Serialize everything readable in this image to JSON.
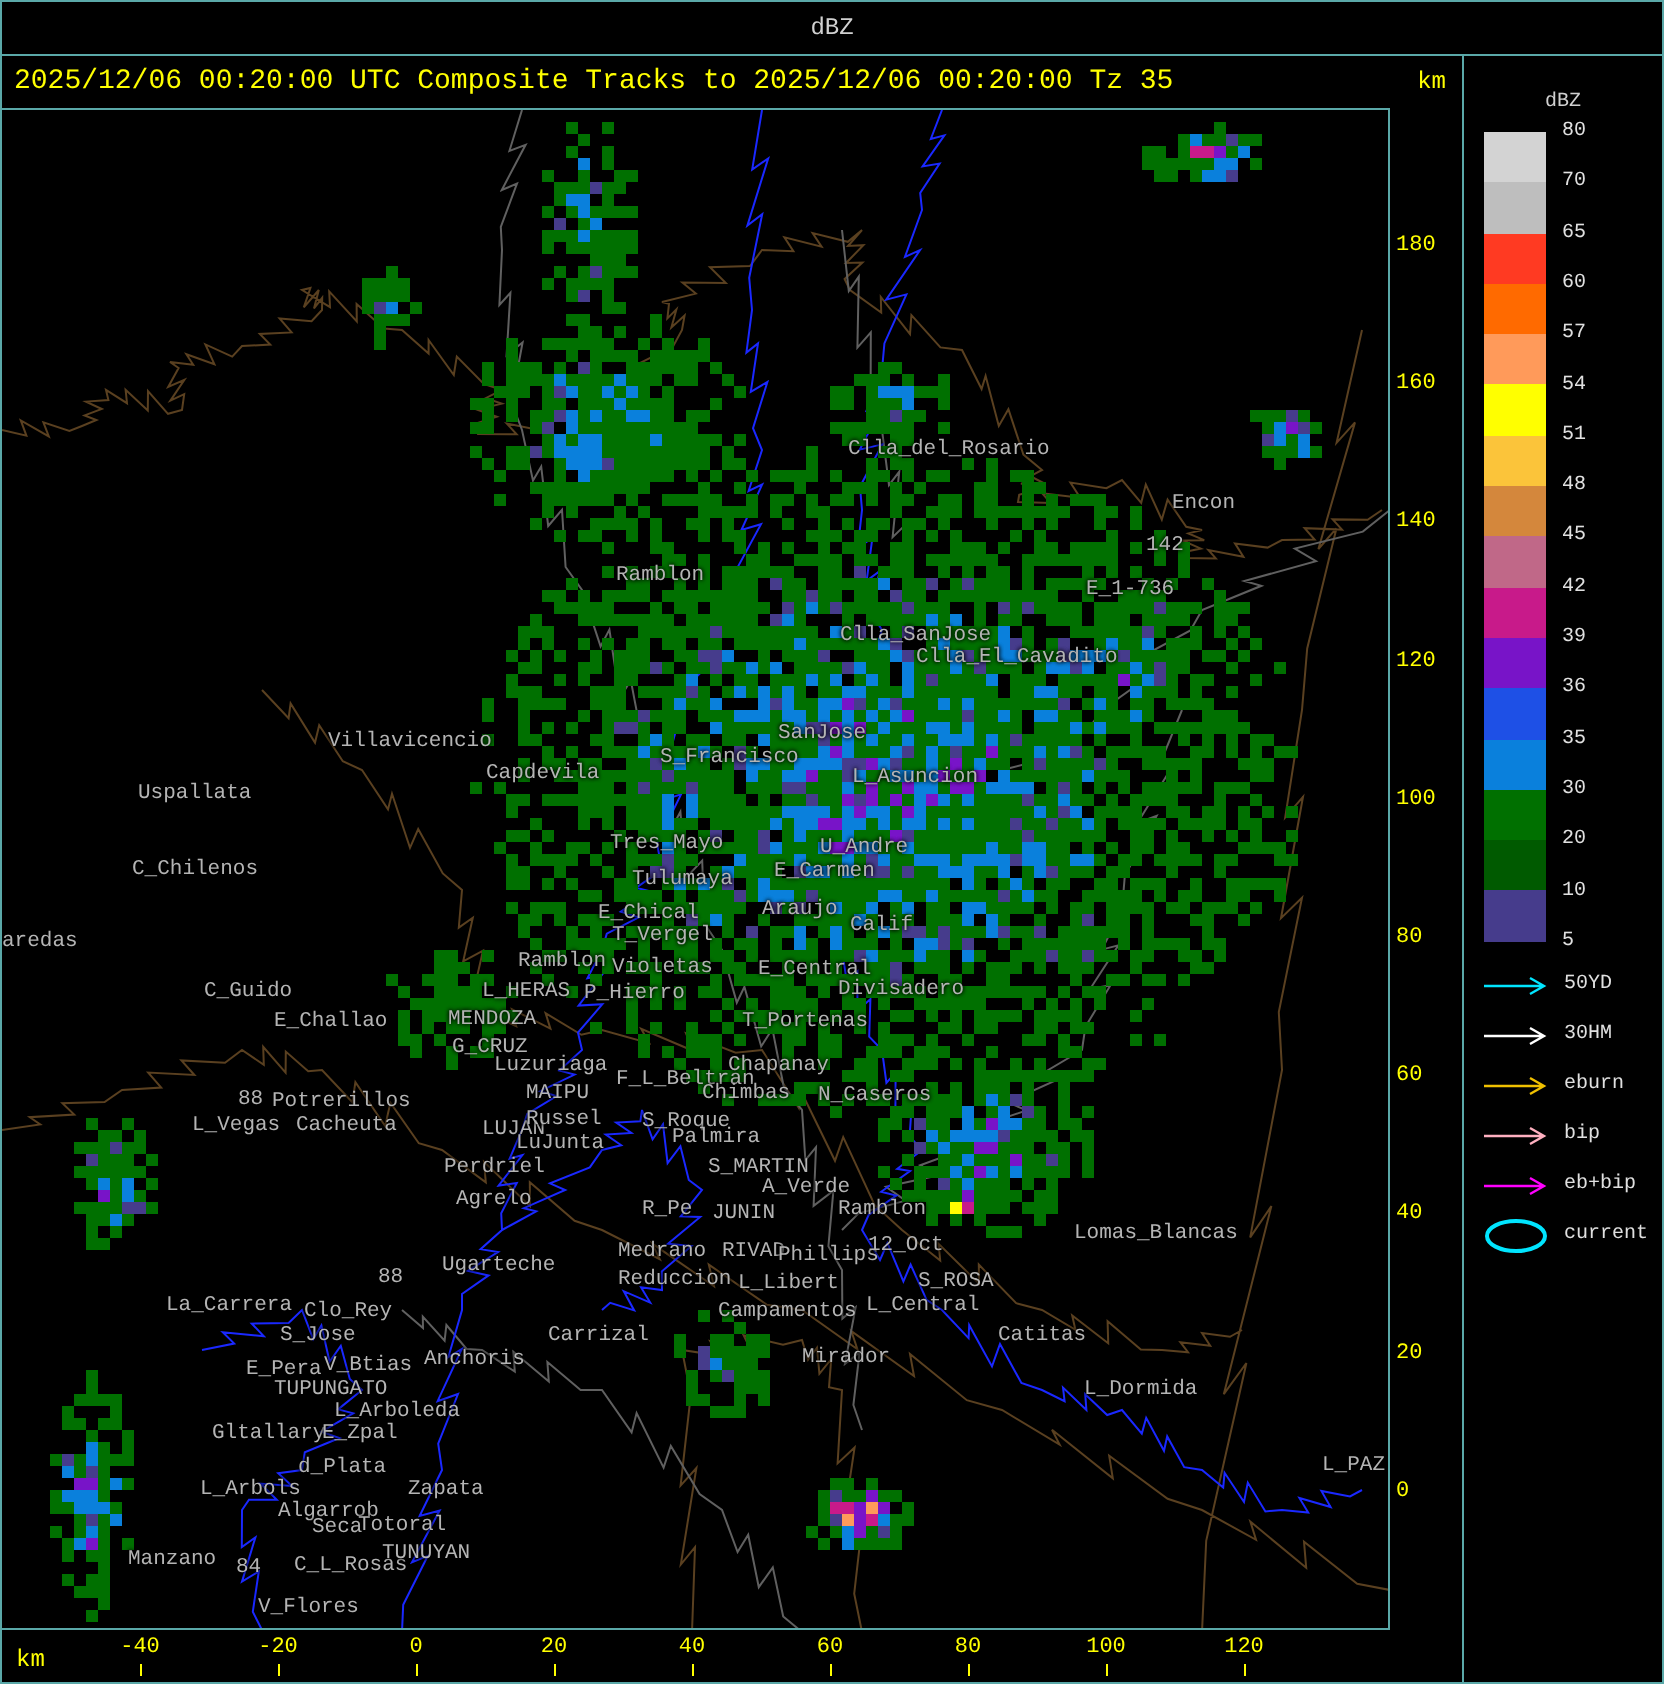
{
  "window": {
    "title": "dBZ"
  },
  "header": {
    "caption": "2025/12/06 00:20:00 UTC Composite Tracks to 2025/12/06 00:20:00 Tz 35",
    "unit": "km"
  },
  "map": {
    "places": [
      {
        "name": "Clla_del_Rosario"
      },
      {
        "name": "Encon"
      },
      {
        "name": "142"
      },
      {
        "name": "Ramblon"
      },
      {
        "name": "E_1-736"
      },
      {
        "name": "Clla_SanJose"
      },
      {
        "name": "Clla_El_Cavadito"
      },
      {
        "name": "Villavicencio"
      },
      {
        "name": "SanJose"
      },
      {
        "name": "Uspallata"
      },
      {
        "name": "Capdevila"
      },
      {
        "name": "S_Francisco"
      },
      {
        "name": "L_Asuncion"
      },
      {
        "name": "Tres_Mayo"
      },
      {
        "name": "C_Chilenos"
      },
      {
        "name": "Tulumaya"
      },
      {
        "name": "U_Andre"
      },
      {
        "name": "E_Carmen"
      },
      {
        "name": "E_Chical"
      },
      {
        "name": "Araujo"
      },
      {
        "name": "aredas"
      },
      {
        "name": "T_Vergel"
      },
      {
        "name": "Calif"
      },
      {
        "name": "Ramblon"
      },
      {
        "name": "Violetas"
      },
      {
        "name": "E_Central"
      },
      {
        "name": "C_Guido"
      },
      {
        "name": "L_HERAS"
      },
      {
        "name": "P_Hierro"
      },
      {
        "name": "Divisadero"
      },
      {
        "name": "E_Challao"
      },
      {
        "name": "MENDOZA"
      },
      {
        "name": "T_Portenas"
      },
      {
        "name": "G_CRUZ"
      },
      {
        "name": "Luzuriaga"
      },
      {
        "name": "88"
      },
      {
        "name": "Potrerillos"
      },
      {
        "name": "MAIPU"
      },
      {
        "name": "F_L_Beltran"
      },
      {
        "name": "Chapanay"
      },
      {
        "name": "Chimbas"
      },
      {
        "name": "N_Caseros"
      },
      {
        "name": "L_Vegas"
      },
      {
        "name": "Cacheuta"
      },
      {
        "name": "LUJAN"
      },
      {
        "name": "Russel"
      },
      {
        "name": "S_Roque"
      },
      {
        "name": "LuJunta"
      },
      {
        "name": "Palmira"
      },
      {
        "name": "Perdriel"
      },
      {
        "name": "S_MARTIN"
      },
      {
        "name": "Agrelo"
      },
      {
        "name": "A_Verde"
      },
      {
        "name": "R_Pe"
      },
      {
        "name": "JUNIN"
      },
      {
        "name": "Ramblon"
      },
      {
        "name": "88"
      },
      {
        "name": "Ugarteche"
      },
      {
        "name": "Medrano"
      },
      {
        "name": "RIVAD"
      },
      {
        "name": "Phillips"
      },
      {
        "name": "12_Oct"
      },
      {
        "name": "Lomas_Blancas"
      },
      {
        "name": "Reduccion"
      },
      {
        "name": "L_Libert"
      },
      {
        "name": "S_ROSA"
      },
      {
        "name": "La_Carrera"
      },
      {
        "name": "Clo_Rey"
      },
      {
        "name": "Campamentos"
      },
      {
        "name": "L_Central"
      },
      {
        "name": "S_Jose"
      },
      {
        "name": "Carrizal"
      },
      {
        "name": "Catitas"
      },
      {
        "name": "E_Pera"
      },
      {
        "name": "V_Btias"
      },
      {
        "name": "Anchoris"
      },
      {
        "name": "Mirador"
      },
      {
        "name": "TUPUNGATO"
      },
      {
        "name": "L_Dormida"
      },
      {
        "name": "L_Arboleda"
      },
      {
        "name": "Gltallary"
      },
      {
        "name": "E_Zpal"
      },
      {
        "name": "d_Plata"
      },
      {
        "name": "L_PAZ"
      },
      {
        "name": "L_Arbols"
      },
      {
        "name": "Zapata"
      },
      {
        "name": "Algarrob"
      },
      {
        "name": "Seca"
      },
      {
        "name": "Totoral"
      },
      {
        "name": "Manzano"
      },
      {
        "name": "84"
      },
      {
        "name": "C_L_Rosas"
      },
      {
        "name": "TUNUYAN"
      },
      {
        "name": "V_Flores"
      }
    ],
    "y_axis": {
      "ticks": [
        "180",
        "160",
        "140",
        "120",
        "100",
        "80",
        "60",
        "40",
        "20",
        "0"
      ]
    },
    "x_axis": {
      "unit": "km",
      "ticks": [
        "-40",
        "-20",
        "0",
        "20",
        "40",
        "60",
        "80",
        "100",
        "120"
      ]
    }
  },
  "legend": {
    "title": "dBZ",
    "bands": [
      {
        "color": "#d3d3d3"
      },
      {
        "color": "#bebebe"
      },
      {
        "color": "#ff3a22"
      },
      {
        "color": "#ff6a00"
      },
      {
        "color": "#ff9a5a"
      },
      {
        "color": "#ffff00"
      },
      {
        "color": "#fbc43a"
      },
      {
        "color": "#d4873c"
      },
      {
        "color": "#c06888"
      },
      {
        "color": "#c81a8a"
      },
      {
        "color": "#7814c8"
      },
      {
        "color": "#1e50e6"
      },
      {
        "color": "#0a80dc"
      },
      {
        "color": "#007000"
      },
      {
        "color": "#005a00"
      },
      {
        "color": "#463c8c"
      }
    ],
    "ticks": [
      "80",
      "70",
      "65",
      "60",
      "57",
      "54",
      "51",
      "48",
      "45",
      "42",
      "39",
      "36",
      "35",
      "30",
      "20",
      "10",
      "5"
    ],
    "tracks": [
      {
        "label": "50YD",
        "color": "#00e5ff",
        "kind": "arrow"
      },
      {
        "label": "30HM",
        "color": "#ffffff",
        "kind": "arrow"
      },
      {
        "label": "eburn",
        "color": "#f0c000",
        "kind": "arrow"
      },
      {
        "label": "bip",
        "color": "#ffb0c0",
        "kind": "arrow"
      },
      {
        "label": "eb+bip",
        "color": "#ff00ff",
        "kind": "arrow"
      },
      {
        "label": "current",
        "color": "#00e5ff",
        "kind": "ellipse"
      }
    ]
  }
}
